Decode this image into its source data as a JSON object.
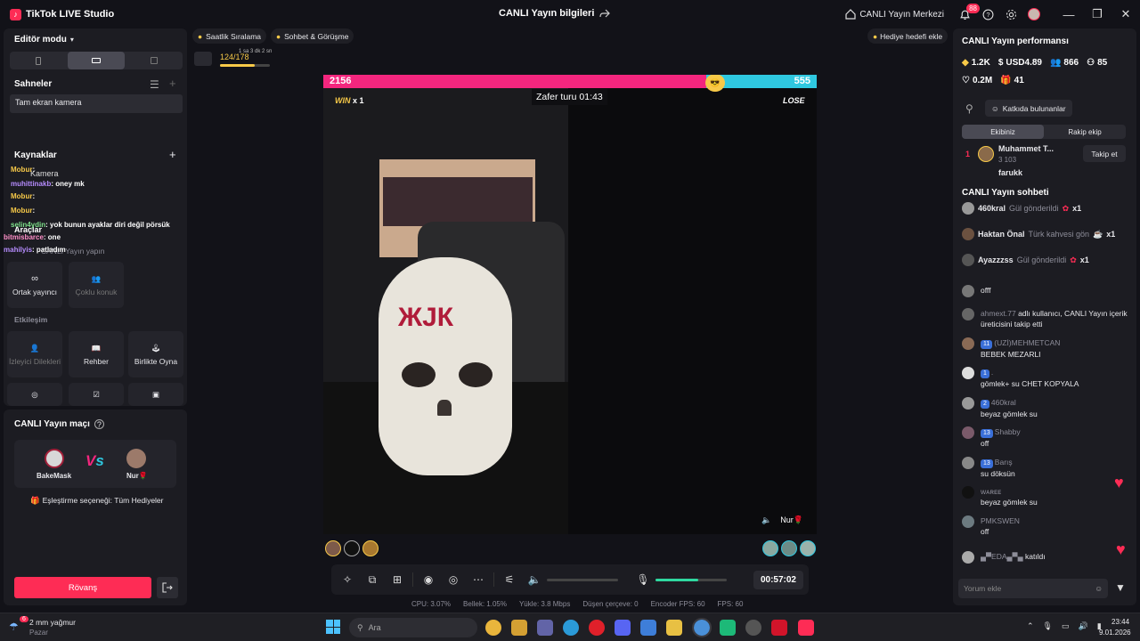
{
  "titlebar": {
    "app_title": "TikTok LIVE Studio",
    "center_title": "CANLI Yayın bilgileri",
    "live_center": "CANLI Yayın Merkezi",
    "notif_count": "88"
  },
  "left": {
    "editor_mode": "Editör modu",
    "scenes_title": "Sahneler",
    "scene_item": "Tam ekran kamera",
    "sources_title": "Kaynaklar",
    "source_camera": "Kamera",
    "tools_title": "Araçlar",
    "tools_sub": "CANLI Yayın yapın",
    "tiles_row1": [
      "Ortak yayıncı",
      "Çoklu konuk"
    ],
    "interaction_title": "Etkileşim",
    "tiles_row2": [
      "İzleyici Dilekleri",
      "Rehber",
      "Birlikte Oyna"
    ],
    "overlay_chat": [
      {
        "user": "Mobur",
        "text": ":"
      },
      {
        "user": "muhittinakb",
        "text": ": oney mk"
      },
      {
        "user": "Mobur",
        "text": ":"
      },
      {
        "user": "Mobur",
        "text": ":"
      },
      {
        "user": "selin4ydin",
        "text": ": yok bunun ayaklar diri değil pörsük"
      },
      {
        "user": "bitmisbarce",
        "text": ": one"
      },
      {
        "user": "mahilyis",
        "text": ": patladım"
      }
    ]
  },
  "match": {
    "title": "CANLI Yayın maçı",
    "player1": "BakeMask",
    "player2": "Nur🌹",
    "pairing": "Eşleştirme seçeneği: Tüm Hediyeler",
    "rematch": "Rövanş"
  },
  "top_pills": {
    "ranking": "Saatlik Sıralama",
    "chat_meet": "Sohbet & Görüşme",
    "gift_goal": "Hediye hedefi ekle",
    "progress_text": "124/178",
    "progress_time": "1 sa 3 dk 2 sn",
    "progress_fraction": 0.697
  },
  "stage": {
    "score_left": "2156",
    "score_right": "555",
    "victory_lap": "Zafer turu 01:43",
    "win": "WIN",
    "win_mult": "x 1",
    "lose": "LOSE",
    "opponent": "Nur🌹"
  },
  "controls": {
    "timer": "00:57:02",
    "volume_level": 0,
    "mic_level": 0.6
  },
  "status": {
    "cpu": "CPU:  3.07%",
    "memory": "Bellek:  1.05%",
    "upload": "Yükle:  3.8 Mbps",
    "dropped": "Düşen çerçeve:  0",
    "encoder": "Encoder FPS:  60",
    "fps": "FPS:  60"
  },
  "right": {
    "perf_title": "CANLI Yayın performansı",
    "stats": [
      "1.2K",
      "USD4.89",
      "866",
      "85",
      "0.2M",
      "41"
    ],
    "contributors": "Katkıda bulunanlar",
    "tab_team": "Ekibiniz",
    "tab_rival": "Rakip ekip",
    "top_user": "Muhammet T...",
    "top_user_stats": "3   103",
    "follow": "Takip et",
    "second_user": "farukk",
    "chat_title": "CANLI Yayın sohbeti",
    "gifts": [
      {
        "user": "460kral",
        "text": "Gül gönderildi",
        "mult": "x1"
      },
      {
        "user": "Haktan Önal",
        "text": "Türk kahvesi gön",
        "mult": "x1"
      },
      {
        "user": "Ayazzzss",
        "text": "Gül gönderildi",
        "mult": "x1"
      }
    ],
    "chat": [
      {
        "user": "",
        "lvl": "",
        "text": "offf"
      },
      {
        "user": "ahmext.77",
        "lvl": "",
        "text": "adlı kullanıcı, CANLI Yayın içerik üreticisini takip etti"
      },
      {
        "user": "(UZİ)MEHMETCAN",
        "lvl": "11",
        "text": "BEBEK MEZARLI"
      },
      {
        "user": ".",
        "lvl": "1",
        "text": "gömlek+ su CHET KOPYALA"
      },
      {
        "user": "460kral",
        "lvl": "2",
        "text": "beyaz gömlek su"
      },
      {
        "user": "Shabby",
        "lvl": "13",
        "text": "off"
      },
      {
        "user": "Barış",
        "lvl": "13",
        "text": "su döksün"
      },
      {
        "user": "ᴡᴀʀᴇᴇ",
        "lvl": "",
        "text": "beyaz gömlek su"
      },
      {
        "user": "PMKSWEN",
        "lvl": "",
        "text": "off"
      },
      {
        "user": "▄▀EDA▄▀▄",
        "lvl": "",
        "text": "katıldı"
      }
    ],
    "comment_placeholder": "Yorum ekle"
  },
  "taskbar": {
    "weather": "2 mm yağmur",
    "weather_sub": "Pazar",
    "weather_badge": "6",
    "search": "Ara",
    "time": "23:44",
    "date": "9.01.2026"
  }
}
